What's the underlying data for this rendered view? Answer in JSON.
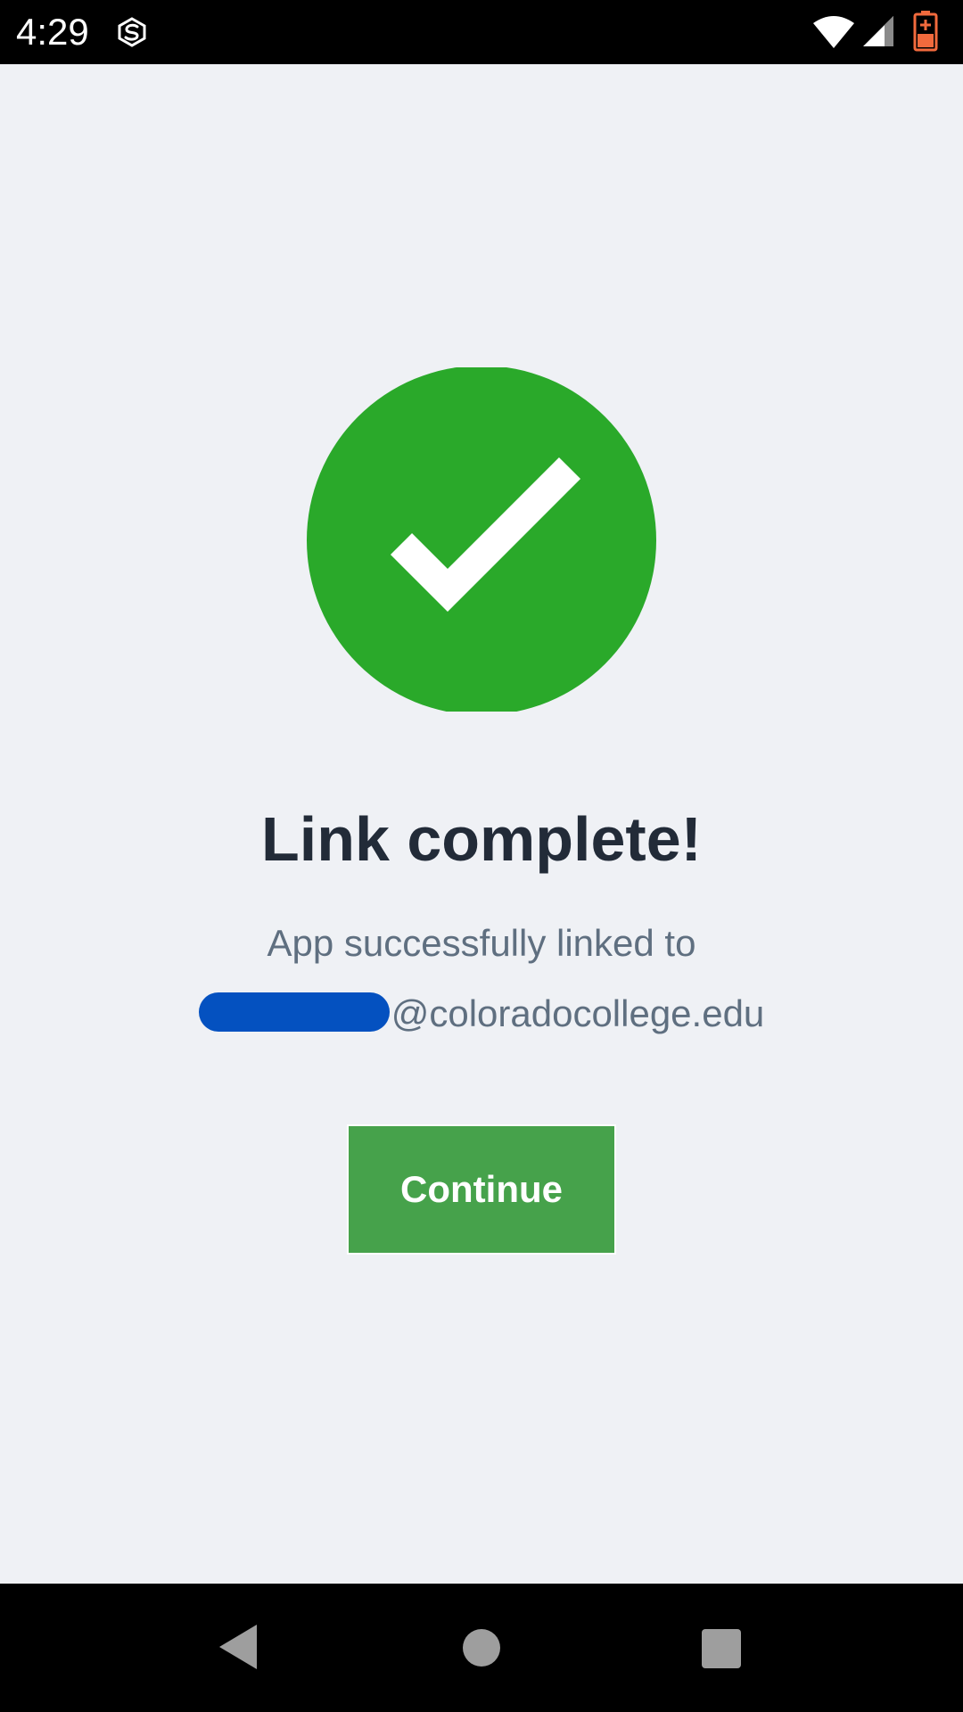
{
  "status_bar": {
    "time": "4:29",
    "icons": [
      "sync-app-icon",
      "wifi-icon",
      "cell-signal-icon",
      "battery-charging-icon"
    ],
    "battery_color": "#f26a3d"
  },
  "main": {
    "icon": "check-circle-icon",
    "icon_color": "#2aa92a",
    "title": "Link complete!",
    "subtitle": "App successfully linked to",
    "email_domain": "@coloradocollege.edu",
    "redaction_color": "#0451c0",
    "continue_label": "Continue",
    "button_color": "#46a24b"
  },
  "nav_bar": {
    "buttons": [
      "back-icon",
      "home-icon",
      "recents-icon"
    ]
  }
}
